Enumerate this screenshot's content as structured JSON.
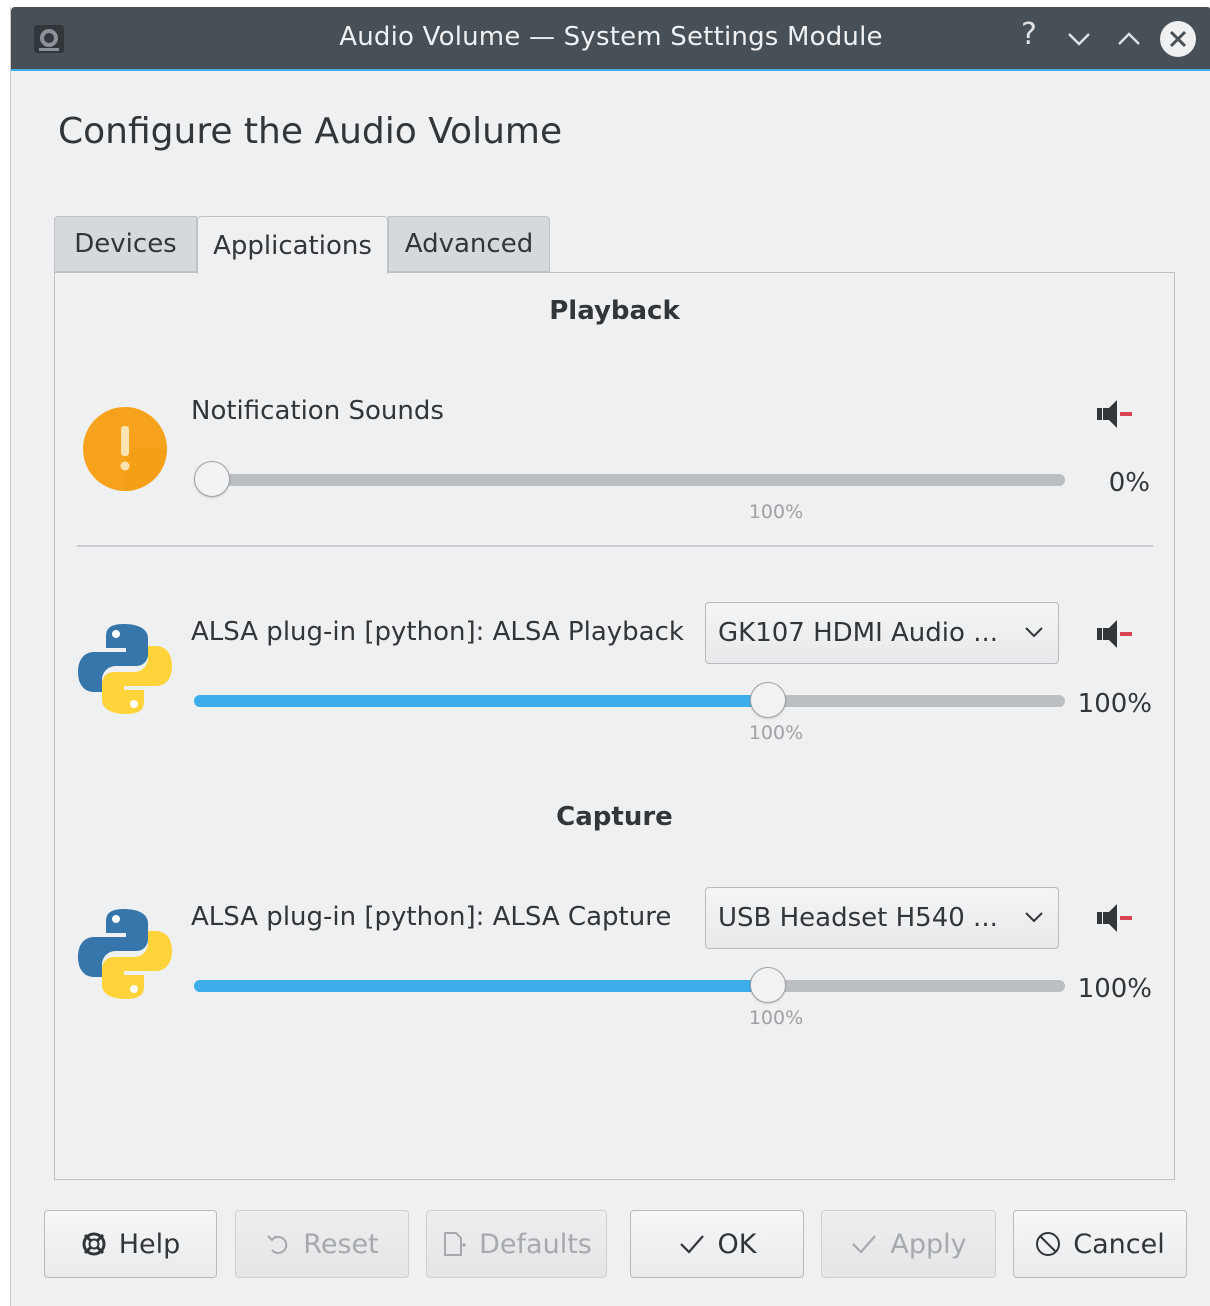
{
  "window": {
    "title": "Audio Volume — System Settings Module",
    "help_glyph": "?"
  },
  "page": {
    "heading": "Configure the Audio Volume"
  },
  "tabs": [
    {
      "label": "Devices",
      "selected": false
    },
    {
      "label": "Applications",
      "selected": true
    },
    {
      "label": "Advanced",
      "selected": false
    }
  ],
  "playback": {
    "title": "Playback",
    "streams": [
      {
        "name": "Notification Sounds",
        "icon": "warning-icon",
        "percent": "0%",
        "volume": 0,
        "tick_label": "100%",
        "muted_icon": "speaker-muted-icon"
      },
      {
        "name": "ALSA plug-in [python]: ALSA Playback",
        "icon": "python-icon",
        "device": "GK107 HDMI Audio ...",
        "percent": "100%",
        "volume": 1.0,
        "tick_label": "100%",
        "muted_icon": "speaker-muted-icon"
      }
    ]
  },
  "capture": {
    "title": "Capture",
    "streams": [
      {
        "name": "ALSA plug-in [python]: ALSA Capture",
        "icon": "python-icon",
        "device": "USB Headset H540 ...",
        "percent": "100%",
        "volume": 1.0,
        "tick_label": "100%",
        "muted_icon": "speaker-muted-icon"
      }
    ]
  },
  "buttons": {
    "help": "Help",
    "reset": "Reset",
    "defaults": "Defaults",
    "ok": "OK",
    "apply": "Apply",
    "cancel": "Cancel"
  },
  "colors": {
    "accent": "#3daee9",
    "titlebar": "#475057",
    "mute_red": "#da4453",
    "warning": "#f7a21c"
  }
}
